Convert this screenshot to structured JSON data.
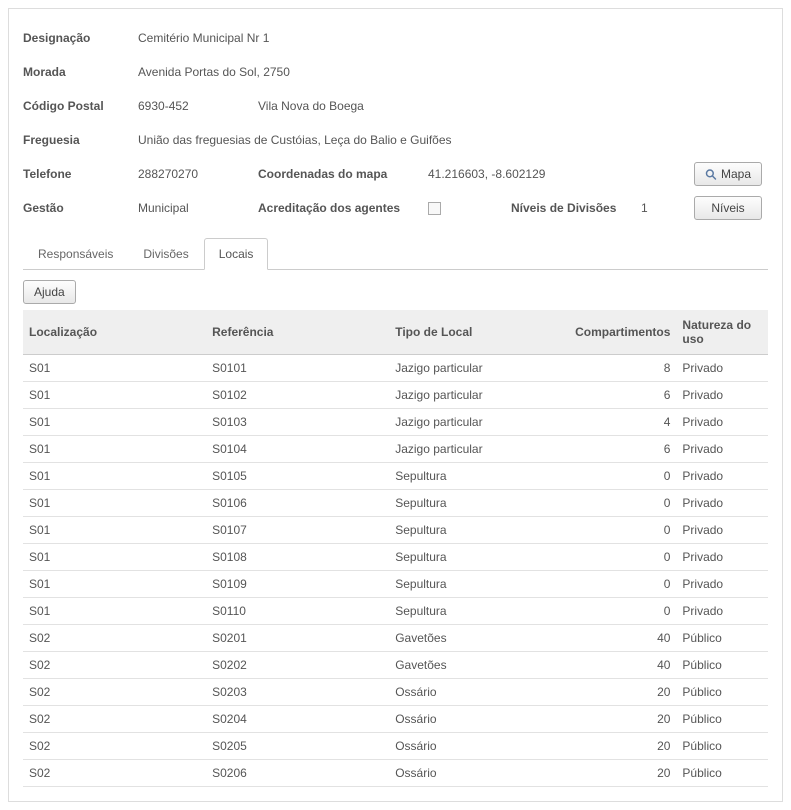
{
  "form": {
    "designacao_label": "Designação",
    "designacao_value": "Cemitério Municipal Nr 1",
    "morada_label": "Morada",
    "morada_value": "Avenida Portas do Sol, 2750",
    "codigo_postal_label": "Código Postal",
    "codigo_postal_value": "6930-452",
    "localidade_value": "Vila Nova do Boega",
    "freguesia_label": "Freguesia",
    "freguesia_value": "União das freguesias de Custóias, Leça do Balio e Guifões",
    "telefone_label": "Telefone",
    "telefone_value": "288270270",
    "coordenadas_label": "Coordenadas do mapa",
    "coordenadas_value": "41.216603, -8.602129",
    "mapa_button": "Mapa",
    "gestao_label": "Gestão",
    "gestao_value": "Municipal",
    "acreditacao_label": "Acreditação dos agentes",
    "niveis_label": "Níveis de Divisões",
    "niveis_value": "1",
    "niveis_button": "Níveis"
  },
  "tabs": {
    "responsaveis": "Responsáveis",
    "divisoes": "Divisões",
    "locais": "Locais"
  },
  "toolbar": {
    "ajuda": "Ajuda"
  },
  "table": {
    "headers": {
      "localizacao": "Localização",
      "referencia": "Referência",
      "tipo": "Tipo de Local",
      "compartimentos": "Compartimentos",
      "natureza": "Natureza do uso"
    },
    "rows": [
      {
        "loc": "S01",
        "ref": "S0101",
        "tipo": "Jazigo particular",
        "comp": "8",
        "nat": "Privado"
      },
      {
        "loc": "S01",
        "ref": "S0102",
        "tipo": "Jazigo particular",
        "comp": "6",
        "nat": "Privado"
      },
      {
        "loc": "S01",
        "ref": "S0103",
        "tipo": "Jazigo particular",
        "comp": "4",
        "nat": "Privado"
      },
      {
        "loc": "S01",
        "ref": "S0104",
        "tipo": "Jazigo particular",
        "comp": "6",
        "nat": "Privado"
      },
      {
        "loc": "S01",
        "ref": "S0105",
        "tipo": "Sepultura",
        "comp": "0",
        "nat": "Privado"
      },
      {
        "loc": "S01",
        "ref": "S0106",
        "tipo": "Sepultura",
        "comp": "0",
        "nat": "Privado"
      },
      {
        "loc": "S01",
        "ref": "S0107",
        "tipo": "Sepultura",
        "comp": "0",
        "nat": "Privado"
      },
      {
        "loc": "S01",
        "ref": "S0108",
        "tipo": "Sepultura",
        "comp": "0",
        "nat": "Privado"
      },
      {
        "loc": "S01",
        "ref": "S0109",
        "tipo": "Sepultura",
        "comp": "0",
        "nat": "Privado"
      },
      {
        "loc": "S01",
        "ref": "S0110",
        "tipo": "Sepultura",
        "comp": "0",
        "nat": "Privado"
      },
      {
        "loc": "S02",
        "ref": "S0201",
        "tipo": "Gavetões",
        "comp": "40",
        "nat": "Público"
      },
      {
        "loc": "S02",
        "ref": "S0202",
        "tipo": "Gavetões",
        "comp": "40",
        "nat": "Público"
      },
      {
        "loc": "S02",
        "ref": "S0203",
        "tipo": "Ossário",
        "comp": "20",
        "nat": "Público"
      },
      {
        "loc": "S02",
        "ref": "S0204",
        "tipo": "Ossário",
        "comp": "20",
        "nat": "Público"
      },
      {
        "loc": "S02",
        "ref": "S0205",
        "tipo": "Ossário",
        "comp": "20",
        "nat": "Público"
      },
      {
        "loc": "S02",
        "ref": "S0206",
        "tipo": "Ossário",
        "comp": "20",
        "nat": "Público"
      }
    ]
  }
}
